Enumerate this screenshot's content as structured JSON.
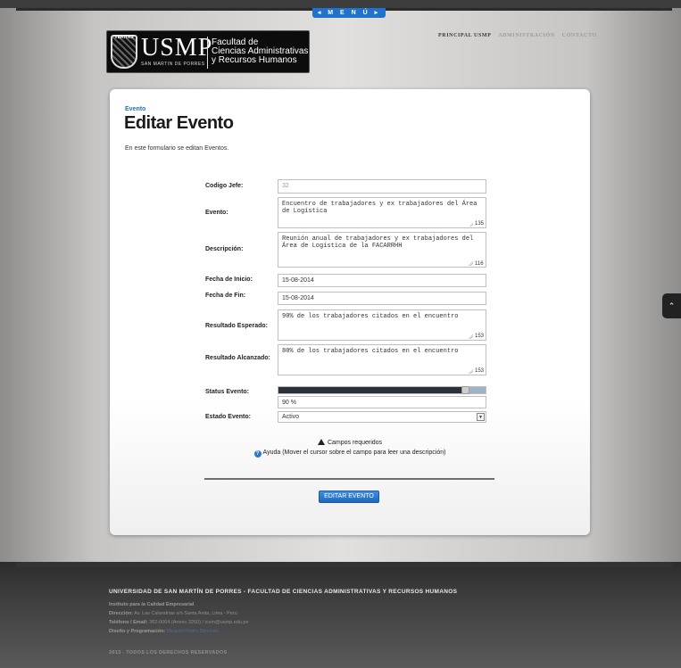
{
  "topbar": {
    "menu_label": "◂  M E N Ú  ▸"
  },
  "logo": {
    "crest_text": "VERITAS",
    "brand": "USMP",
    "brand_sub": "SAN MARTIN DE PORRES",
    "faculty_line1": "Facultad de",
    "faculty_line2": "Ciencias Administrativas",
    "faculty_line3": "y Recursos Humanos"
  },
  "topnav": [
    "PRINCIPAL USMP",
    "ADMINISTRACIÓN",
    "CONTACTO"
  ],
  "card": {
    "breadcrumb": "Evento",
    "title": "Editar Evento",
    "intro": "En este formulario se editan Eventos."
  },
  "form": {
    "codigo_jefe": {
      "label": "Codigo Jefe:",
      "value": "32"
    },
    "evento": {
      "label": "Evento:",
      "value": "Encuentro de trabajadores y ex trabajadores del Área de Logística",
      "counter": "135"
    },
    "descripcion": {
      "label": "Descripción:",
      "value": "Reunión anual de trabajadores y ex trabajadores del Área de Logística de la FACARRHH",
      "counter": "116"
    },
    "fecha_inicio": {
      "label": "Fecha de Inicio:",
      "value": "15-08-2014"
    },
    "fecha_fin": {
      "label": "Fecha de Fin:",
      "value": "15-08-2014"
    },
    "resultado_esperado": {
      "label": "Resultado Esperado:",
      "value": "90% de los trabajadores citados en el encuentro",
      "counter": "153"
    },
    "resultado_alcanzado": {
      "label": "Resultado Alcanzado:",
      "value": "80% de los trabajadores citados en el encuentro",
      "counter": "153"
    },
    "status_evento": {
      "label": "Status Evento:",
      "percent": 90,
      "value_text": "90 %"
    },
    "estado_evento": {
      "label": "Estado Evento:",
      "selected": "Activo"
    },
    "required_note": "Campos requeridos",
    "help_note": "Ayuda (Mover el cursor sobre el campo para leer una descripción)",
    "submit_label": "EDITAR EVENTO"
  },
  "side_button": {
    "icon": "chevron-up-icon",
    "glyph": "⌃"
  },
  "footer": {
    "title": "UNIVERSIDAD DE SAN MARTÍN DE PORRES - FACULTAD DE CIENCIAS ADMINISTRATIVAS Y RECURSOS HUMANOS",
    "institute": "Instituto para la Calidad Empresarial",
    "direccion_label": "Dirección:",
    "direccion_value": "Av. Las Calandrias s/n Santa Anita, Lima - Perú",
    "telefono_label": "Teléfono / Email:",
    "telefono_value": "362-0064 (Anexo 3260) / icem@usmp.edu.pe",
    "diseno_label": "Diseño y Programación:",
    "diseno_value": "Ricardo Pedro Sánchez",
    "copyright": "2013 - TODOS LOS DERECHOS RESERVADOS"
  }
}
